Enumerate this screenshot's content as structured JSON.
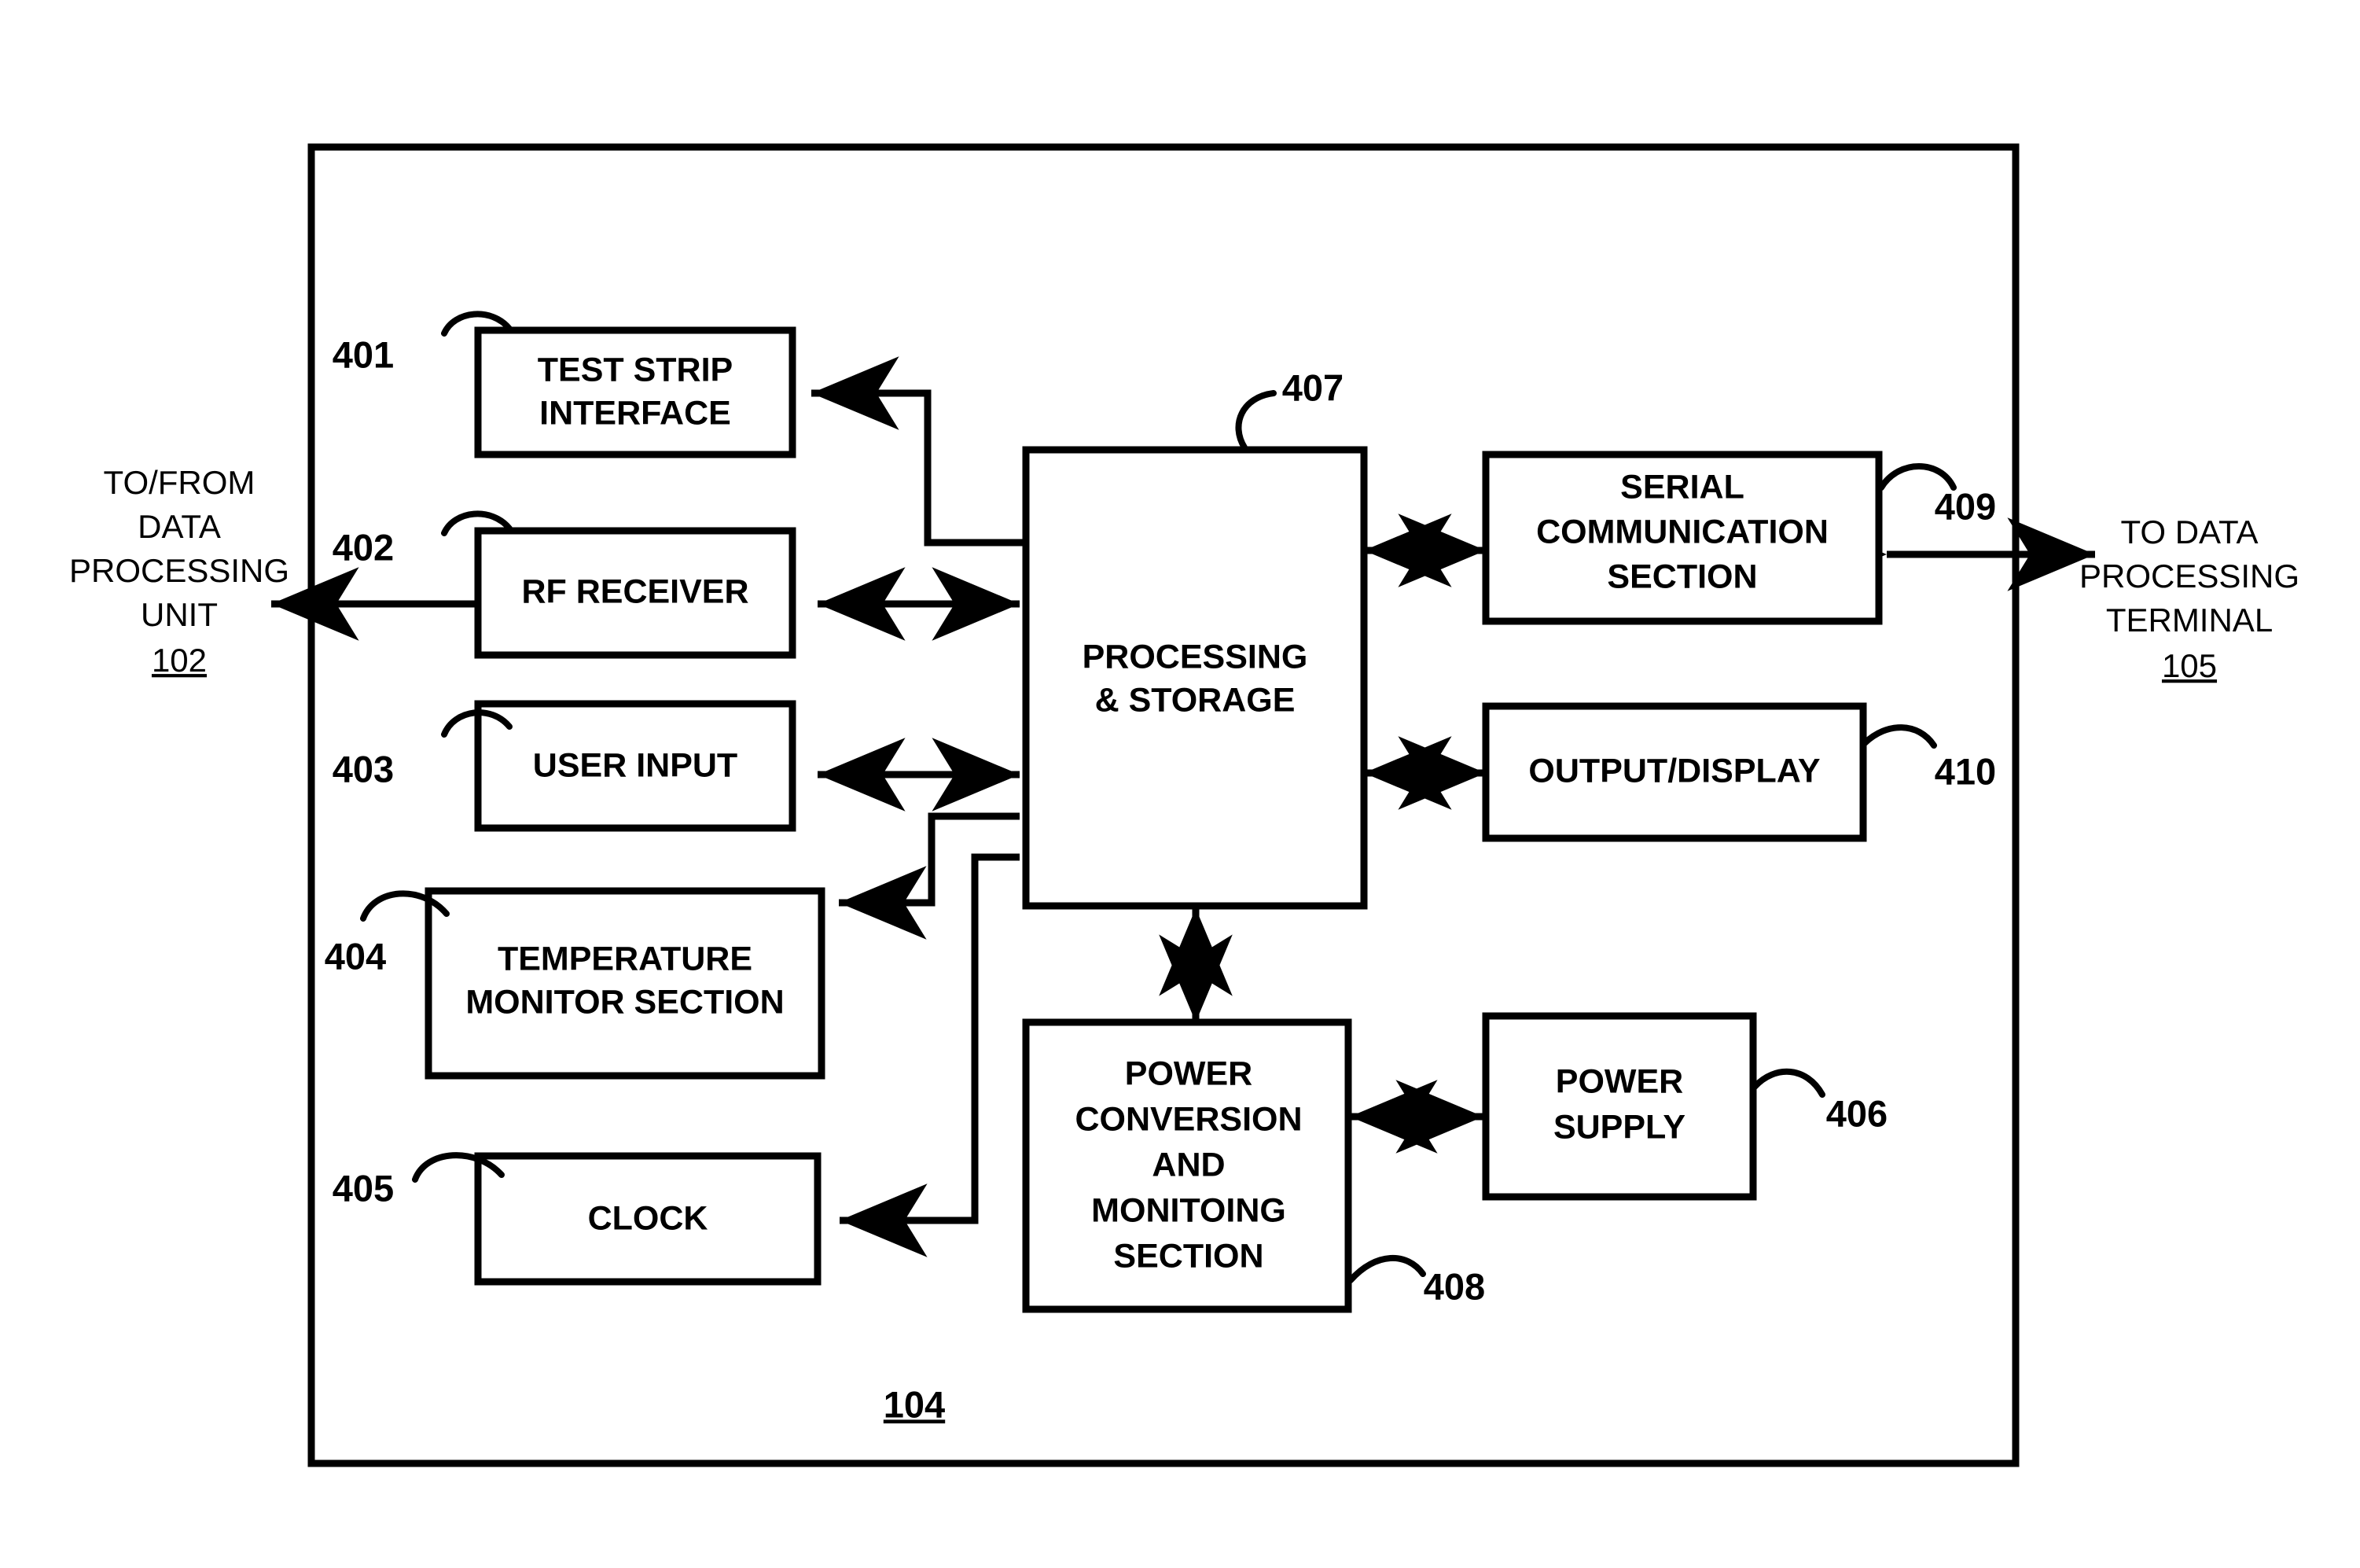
{
  "figure": {
    "enclosure_ref": "104",
    "blocks": [
      {
        "id": "test-strip-interface",
        "ref": "401",
        "lines": [
          "TEST STRIP",
          "INTERFACE"
        ]
      },
      {
        "id": "rf-receiver",
        "ref": "402",
        "lines": [
          "RF RECEIVER"
        ]
      },
      {
        "id": "user-input",
        "ref": "403",
        "lines": [
          "USER INPUT"
        ]
      },
      {
        "id": "temperature-monitor-section",
        "ref": "404",
        "lines": [
          "TEMPERATURE",
          "MONITOR SECTION"
        ]
      },
      {
        "id": "clock",
        "ref": "405",
        "lines": [
          "CLOCK"
        ]
      },
      {
        "id": "power-supply",
        "ref": "406",
        "lines": [
          "POWER",
          "SUPPLY"
        ]
      },
      {
        "id": "processing-and-storage",
        "ref": "407",
        "lines": [
          "PROCESSING",
          "& STORAGE"
        ]
      },
      {
        "id": "power-conversion-and-monitoing-section",
        "ref": "408",
        "lines": [
          "POWER",
          "CONVERSION",
          "AND",
          "MONITOING",
          "SECTION"
        ]
      },
      {
        "id": "serial-communication-section",
        "ref": "409",
        "lines": [
          "SERIAL",
          "COMMUNICATION",
          "SECTION"
        ]
      },
      {
        "id": "output-display",
        "ref": "410",
        "lines": [
          "OUTPUT/DISPLAY"
        ]
      }
    ],
    "external_left": {
      "lines": [
        "TO/FROM",
        "DATA",
        "PROCESSING",
        "UNIT"
      ],
      "ref": "102"
    },
    "external_right": {
      "lines": [
        "TO DATA",
        "PROCESSING",
        "TERMINAL"
      ],
      "ref": "105"
    },
    "colors": {
      "ink": "#000000",
      "background": "#ffffff"
    }
  }
}
